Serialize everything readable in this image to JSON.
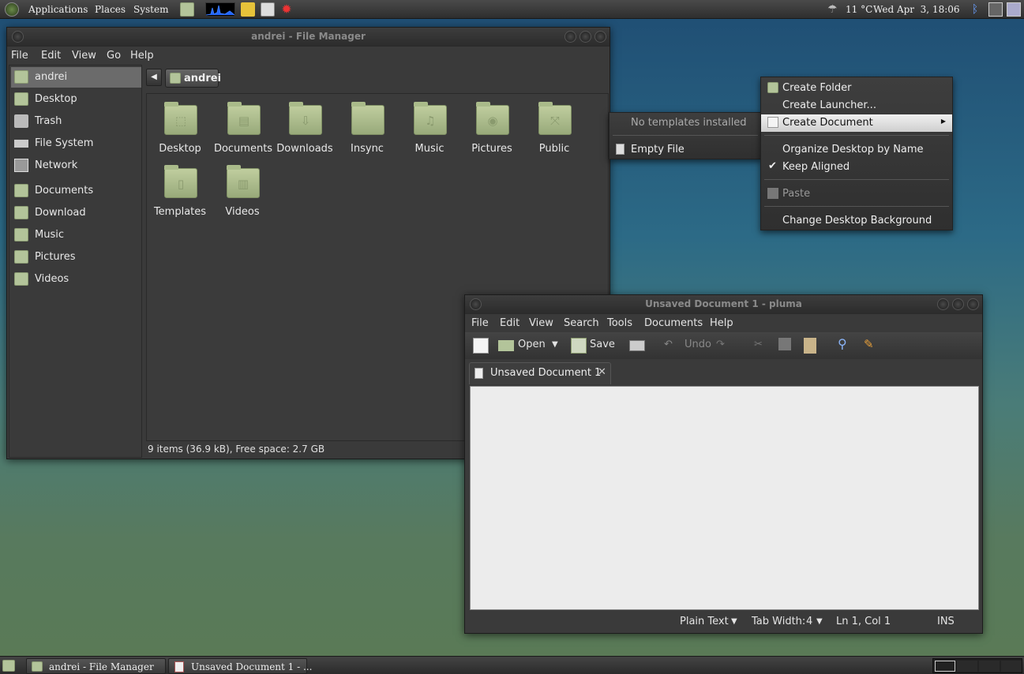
{
  "top_panel": {
    "menus": [
      "Applications",
      "Places",
      "System"
    ],
    "weather": "11 °C",
    "clock": "Wed Apr  3, 18:06"
  },
  "file_manager": {
    "title": "andrei - File Manager",
    "menus": [
      "File",
      "Edit",
      "View",
      "Go",
      "Help"
    ],
    "path_button": "andrei",
    "sidebar": [
      "andrei",
      "Desktop",
      "Trash",
      "File System",
      "Network",
      "Documents",
      "Download",
      "Music",
      "Pictures",
      "Videos"
    ],
    "items": [
      "Desktop",
      "Documents",
      "Downloads",
      "Insync",
      "Music",
      "Pictures",
      "Public",
      "Templates",
      "Videos"
    ],
    "status": "9 items (36.9 kB), Free space: 2.7 GB"
  },
  "desktop_menu": {
    "items": [
      "Create Folder",
      "Create Launcher...",
      "Create Document",
      "Organize Desktop by Name",
      "Keep Aligned",
      "Paste",
      "Change Desktop Background"
    ]
  },
  "submenu": {
    "items": [
      "No templates installed",
      "Empty File"
    ]
  },
  "pluma": {
    "title": "Unsaved Document 1 - pluma",
    "menus": [
      "File",
      "Edit",
      "View",
      "Search",
      "Tools",
      "Documents",
      "Help"
    ],
    "toolbar": {
      "open": "Open",
      "save": "Save",
      "undo": "Undo"
    },
    "tab": "Unsaved Document 1",
    "status": {
      "language": "Plain Text",
      "tab_width_label": "Tab Width:",
      "tab_width": "4",
      "position": "Ln 1, Col 1",
      "mode": "INS"
    }
  },
  "bottom_panel": {
    "tasks": [
      "andrei - File Manager",
      "Unsaved Document 1 - ..."
    ]
  }
}
